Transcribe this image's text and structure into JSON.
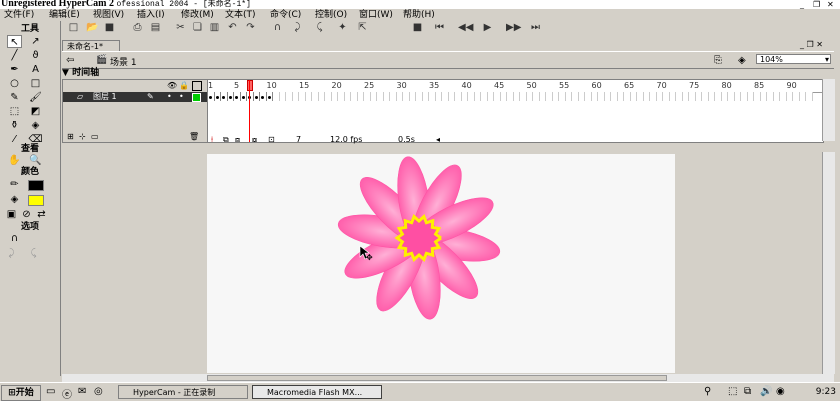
{
  "window": {
    "title": "Unregistered HyperCam 2",
    "title_suffix": "ofessional 2004 - [未命名-1*]"
  },
  "menu": [
    "文件(F)",
    "编辑(E)",
    "视图(V)",
    "插入(I)",
    "修改(M)",
    "文本(T)",
    "命令(C)",
    "控制(O)",
    "窗口(W)",
    "帮助(H)"
  ],
  "tools_panel": {
    "title": "工具",
    "view_title": "查看",
    "colors_title": "颜色",
    "options_title": "选项"
  },
  "document": {
    "tab_label": "未命名-1*",
    "scene_label": "场景 1",
    "zoom": "104%"
  },
  "timeline": {
    "title": "时间轴",
    "layer_name": "图层 1",
    "ruler_labels": [
      "1",
      "5",
      "10",
      "15",
      "20",
      "25",
      "30",
      "35",
      "40",
      "45",
      "50",
      "55",
      "60",
      "65",
      "70",
      "75",
      "80",
      "85",
      "90"
    ],
    "current_frame": "7",
    "fps": "12.0 fps",
    "time": "0.5s",
    "filled_frames": 10
  },
  "taskbar": {
    "start": "开始",
    "tasks": [
      "HyperCam - 正在录制",
      "Macromedia Flash MX..."
    ],
    "clock": "9:23"
  },
  "colors": {
    "petal": "#ff4fa3",
    "petal_light": "#ffb0d6",
    "center_yellow": "#ffef00",
    "fill_swatch": "#ffff00"
  }
}
